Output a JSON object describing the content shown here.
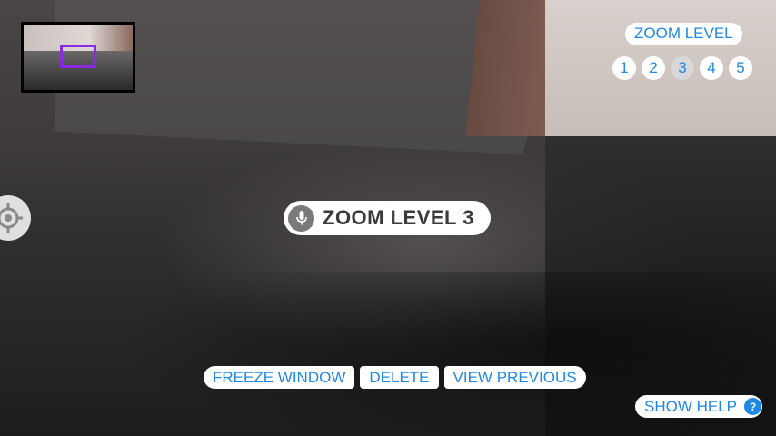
{
  "zoom": {
    "title": "ZOOM LEVEL",
    "levels": [
      "1",
      "2",
      "3",
      "4",
      "5"
    ],
    "current": "3"
  },
  "status": {
    "text": "ZOOM LEVEL 3",
    "icon": "microphone-icon"
  },
  "actions": {
    "freeze": "FREEZE WINDOW",
    "delete": "DELETE",
    "view_previous": "VIEW PREVIOUS"
  },
  "help": {
    "label": "SHOW HELP",
    "icon_glyph": "?"
  },
  "colors": {
    "accent": "#1e88e5",
    "minimap_viewport": "#8a2be2"
  },
  "icons": {
    "crosshair": "crosshair-icon",
    "microphone": "microphone-icon",
    "help": "help-icon"
  }
}
